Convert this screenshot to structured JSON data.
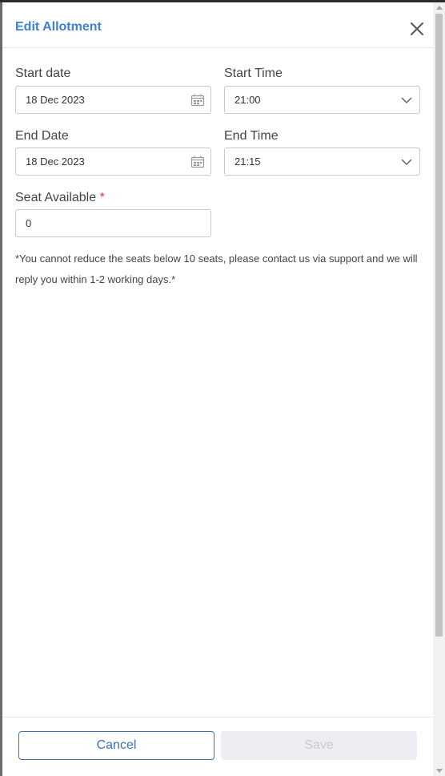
{
  "dialog": {
    "title": "Edit Allotment"
  },
  "form": {
    "start_date": {
      "label": "Start date",
      "value": "18 Dec 2023",
      "icon": "calendar-icon"
    },
    "start_time": {
      "label": "Start Time",
      "value": "21:00",
      "icon": "chevron-down-icon"
    },
    "end_date": {
      "label": "End Date",
      "value": "18 Dec 2023",
      "icon": "calendar-icon"
    },
    "end_time": {
      "label": "End Time",
      "value": "21:15",
      "icon": "chevron-down-icon"
    },
    "seat_available": {
      "label": "Seat Available",
      "required_mark": "*",
      "value": "0"
    }
  },
  "note": "*You cannot reduce the seats below 10 seats, please contact us via support and we will reply you within 1-2 working days.*",
  "footer": {
    "cancel_label": "Cancel",
    "save_label": "Save"
  },
  "colors": {
    "accent": "#3f7fd0",
    "required": "#e03a3a",
    "save_disabled_bg": "#eeeef2"
  }
}
